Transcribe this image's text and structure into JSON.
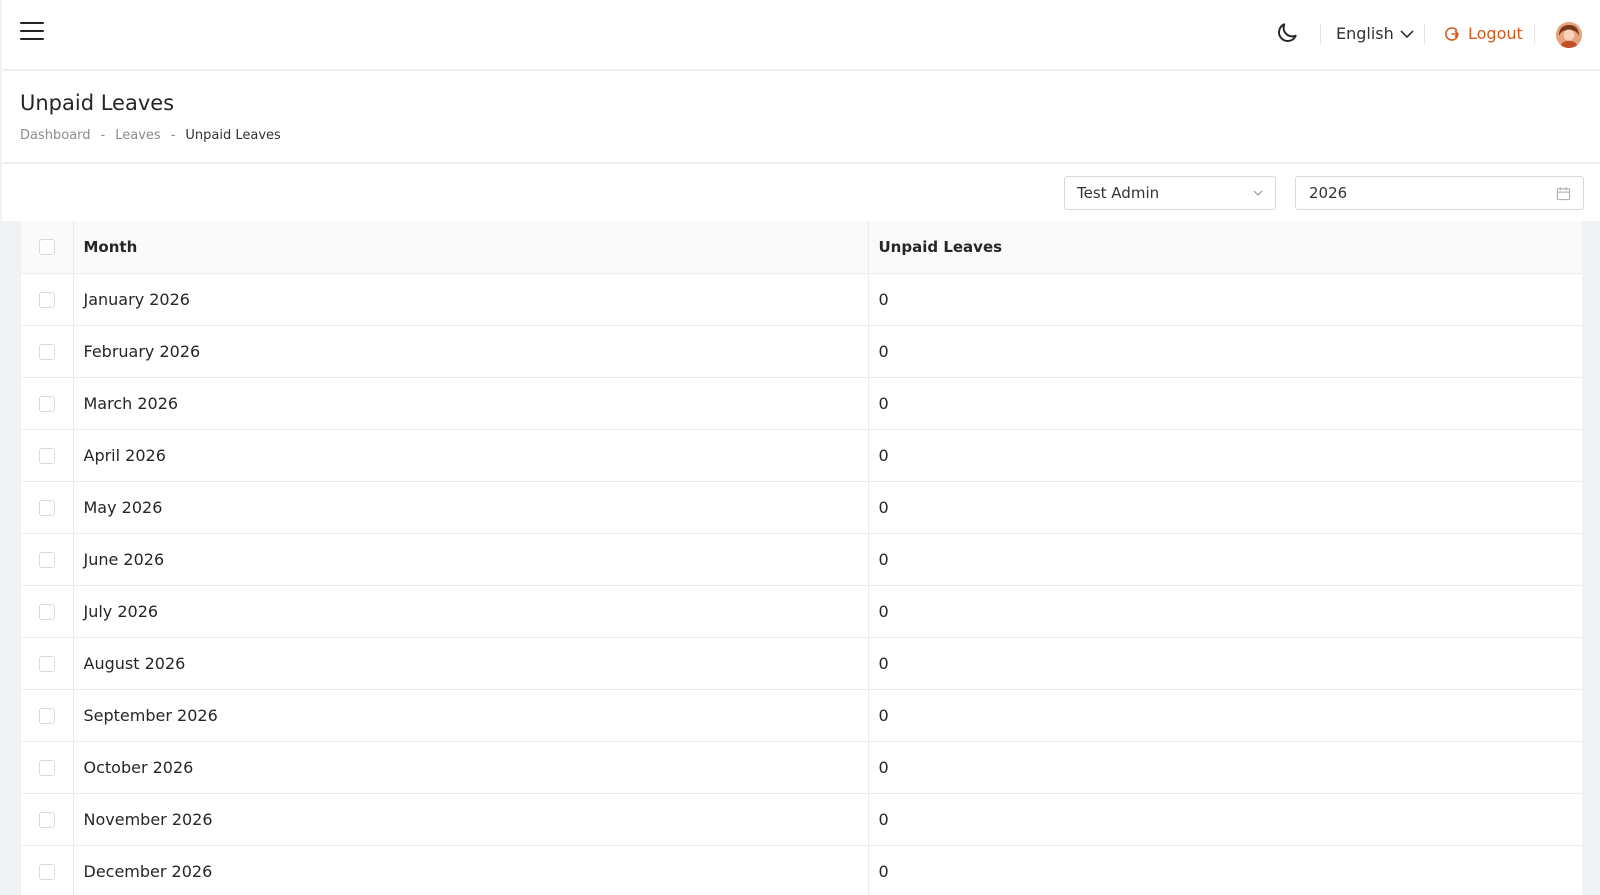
{
  "topbar": {
    "language": "English",
    "logout_label": "Logout"
  },
  "header": {
    "title": "Unpaid Leaves",
    "breadcrumb": [
      "Dashboard",
      "Leaves",
      "Unpaid Leaves"
    ],
    "breadcrumb_separator": "-"
  },
  "filters": {
    "employee": "Test Admin",
    "year": "2026"
  },
  "table": {
    "columns": [
      "Month",
      "Unpaid Leaves"
    ],
    "rows": [
      {
        "month": "January 2026",
        "unpaid": "0"
      },
      {
        "month": "February 2026",
        "unpaid": "0"
      },
      {
        "month": "March 2026",
        "unpaid": "0"
      },
      {
        "month": "April 2026",
        "unpaid": "0"
      },
      {
        "month": "May 2026",
        "unpaid": "0"
      },
      {
        "month": "June 2026",
        "unpaid": "0"
      },
      {
        "month": "July 2026",
        "unpaid": "0"
      },
      {
        "month": "August 2026",
        "unpaid": "0"
      },
      {
        "month": "September 2026",
        "unpaid": "0"
      },
      {
        "month": "October 2026",
        "unpaid": "0"
      },
      {
        "month": "November 2026",
        "unpaid": "0"
      },
      {
        "month": "December 2026",
        "unpaid": "0"
      }
    ]
  },
  "colors": {
    "accent": "#d55a1e",
    "border": "#ececec"
  },
  "icons": {
    "menu": "hamburger-menu-icon",
    "theme": "moon-icon",
    "language_dropdown": "chevron-down-icon",
    "logout": "logout-icon",
    "user": "avatar",
    "employee_dropdown": "chevron-down-icon",
    "year_picker": "calendar-icon"
  }
}
